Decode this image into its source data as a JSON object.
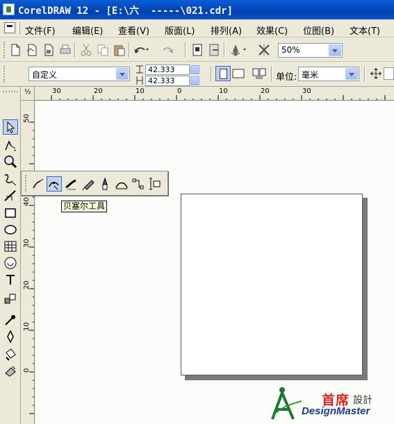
{
  "window": {
    "title": "CorelDRAW 12 - [E:\\六  -----\\021.cdr]"
  },
  "menu": [
    "文件(F)",
    "编辑(E)",
    "查看(V)",
    "版面(L)",
    "排列(A)",
    "效果(C)",
    "位图(B)",
    "文本(T)"
  ],
  "toolbar": {
    "zoom": "50%"
  },
  "propbar": {
    "page_size": "自定义",
    "width": "42.333 mm",
    "height": "42.333 mm",
    "units_label": "单位:",
    "units_value": "毫米"
  },
  "ruler": {
    "h_labels": [
      "30",
      "20",
      "10",
      "0",
      "10",
      "20",
      "30"
    ],
    "v_labels": [
      "50",
      "40",
      "30",
      "20",
      "10",
      "0"
    ],
    "corner": "½"
  },
  "flyout": {
    "tooltip": "贝塞尔工具"
  },
  "watermark": {
    "cn": "首席",
    "cn_small": "設計",
    "en": "DesignMaster"
  },
  "colors": {
    "titlebar": "#0a52c8",
    "canvas": "#fcfdfb",
    "tooltip_bg": "#ffffe1",
    "watermark_red": "#e0201a",
    "watermark_blue": "#1a3a8a"
  },
  "icons": [
    "new-icon",
    "open-icon",
    "save-icon",
    "print-icon",
    "cut-icon",
    "copy-icon",
    "paste-icon",
    "undo-icon",
    "redo-icon",
    "import-icon",
    "export-icon",
    "launcher-icon",
    "options-icon"
  ]
}
